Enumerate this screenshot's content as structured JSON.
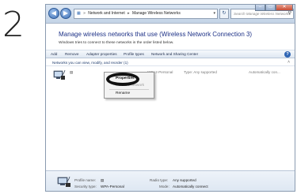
{
  "step": {
    "number": "2"
  },
  "window": {
    "breadcrumb": [
      "Network and Internet",
      "Manage Wireless Networks"
    ],
    "search_placeholder": "Search Manage Wireless Networks",
    "controls": {
      "minimize": "–",
      "maximize": "□",
      "close": "✕"
    }
  },
  "header": {
    "title": "Manage wireless networks that use (Wireless Network Connection 3)",
    "description": "Windows tries to connect to these networks in the order listed below."
  },
  "toolbar": {
    "items": [
      "Add",
      "Remove",
      "Adapter properties",
      "Profile types",
      "Network and Sharing Center"
    ]
  },
  "list": {
    "header": "Networks you can view, modify, and reorder (1)",
    "network": {
      "name": "▤",
      "security": "WPA2-Personal",
      "type": "Type: Any supported",
      "mode": "Automatically con..."
    }
  },
  "context_menu": {
    "items": [
      "Properties",
      "Remove network",
      "Rename"
    ]
  },
  "details": {
    "profile_name_label": "Profile name:",
    "profile_name_value": "▤",
    "security_type_label": "Security type:",
    "security_type_value": "WPA-Personal",
    "radio_type_label": "Radio type:",
    "radio_type_value": "Any supported",
    "mode_label": "Mode:",
    "mode_value": "Automatically connect"
  },
  "colors": {
    "title_blue": "#1e3287",
    "toolbar_text": "#1e2b4a",
    "help_blue": "#2f65b4"
  }
}
